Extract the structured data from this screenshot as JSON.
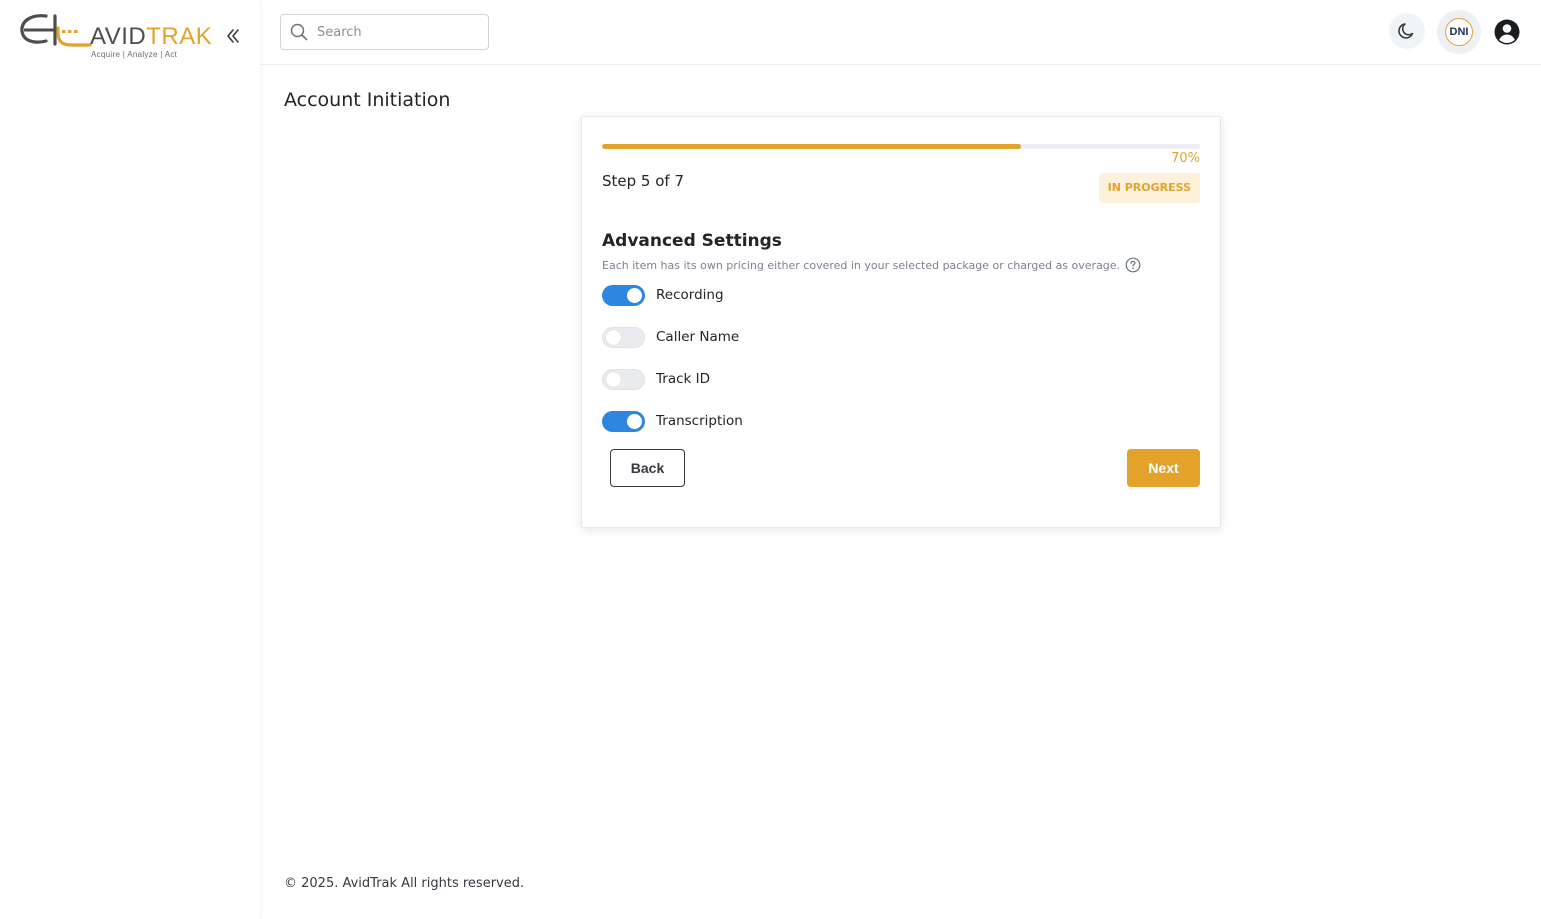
{
  "brand": {
    "name_part1": "AVID",
    "name_part2": "TRAK",
    "tagline": "Acquire  |  Analyze  |  Act"
  },
  "header": {
    "search_placeholder": "Search",
    "dni_label": "DNI"
  },
  "page": {
    "title": "Account Initiation"
  },
  "wizard": {
    "progress_percent": 70,
    "progress_text": "70%",
    "step_label": "Step 5 of 7",
    "status": "IN PROGRESS",
    "section_title": "Advanced Settings",
    "section_description": "Each item has its own pricing either covered in your selected package or charged as overage.",
    "settings": [
      {
        "label": "Recording",
        "enabled": true
      },
      {
        "label": "Caller Name",
        "enabled": false
      },
      {
        "label": "Track ID",
        "enabled": false
      },
      {
        "label": "Transcription",
        "enabled": true
      }
    ],
    "back_label": "Back",
    "next_label": "Next"
  },
  "footer": {
    "copyright": "© 2025. AvidTrak All rights reserved."
  },
  "colors": {
    "accent": "#e3a32b",
    "toggle_on": "#2f86de",
    "toggle_off": "#e9ebee"
  },
  "icons": {
    "collapse": "chevrons-left-icon",
    "search": "search-icon",
    "theme": "moon-icon",
    "profile": "user-circle-icon",
    "help": "question-circle-icon"
  }
}
